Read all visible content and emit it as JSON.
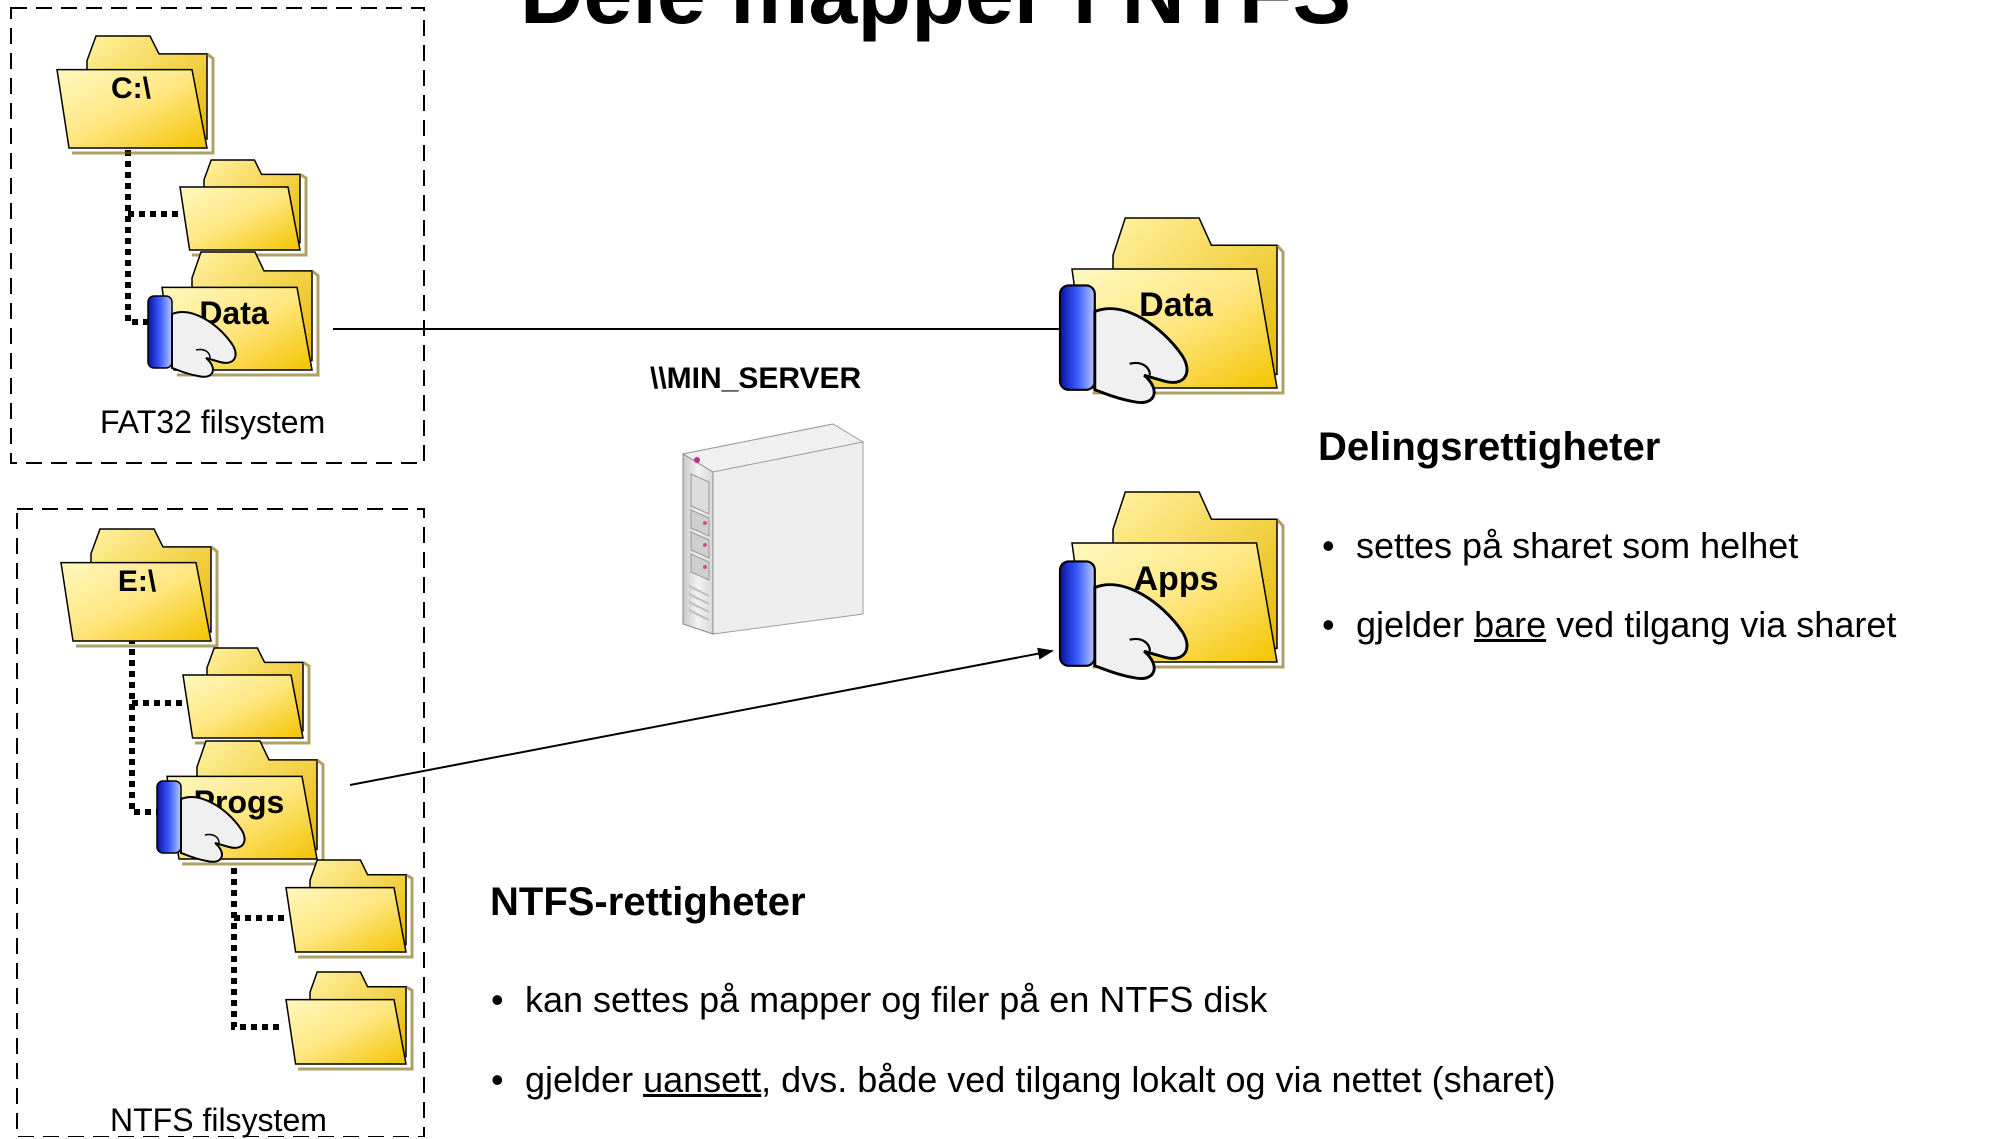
{
  "title": "Dele mapper i NTFS",
  "fat32": {
    "drive": "C:\\",
    "shared_folder": "Data",
    "label": "FAT32 filsystem"
  },
  "ntfs": {
    "drive": "E:\\",
    "shared_folder": "Progs",
    "label": "NTFS filsystem"
  },
  "server": {
    "name": "\\\\MIN_SERVER"
  },
  "shares": {
    "data": "Data",
    "apps": "Apps"
  },
  "share_permissions": {
    "heading": "Delingsrettigheter",
    "bullets": [
      {
        "before": "settes på sharet som helhet",
        "underlined": "",
        "after": ""
      },
      {
        "before": "gjelder ",
        "underlined": "bare",
        "after": " ved tilgang via sharet"
      }
    ]
  },
  "ntfs_permissions": {
    "heading": "NTFS-rettigheter",
    "bullets": [
      {
        "before": "kan settes på mapper og filer på en NTFS disk",
        "underlined": "",
        "after": ""
      },
      {
        "before": "gjelder ",
        "underlined": "uansett",
        "after": ", dvs. både ved tilgang lokalt og via nettet (sharet)"
      }
    ]
  },
  "colors": {
    "folder_fill": "#ffe066",
    "folder_dark": "#e0b400",
    "hand_blue": "#1a2fd0",
    "border_dash": "#000000"
  }
}
